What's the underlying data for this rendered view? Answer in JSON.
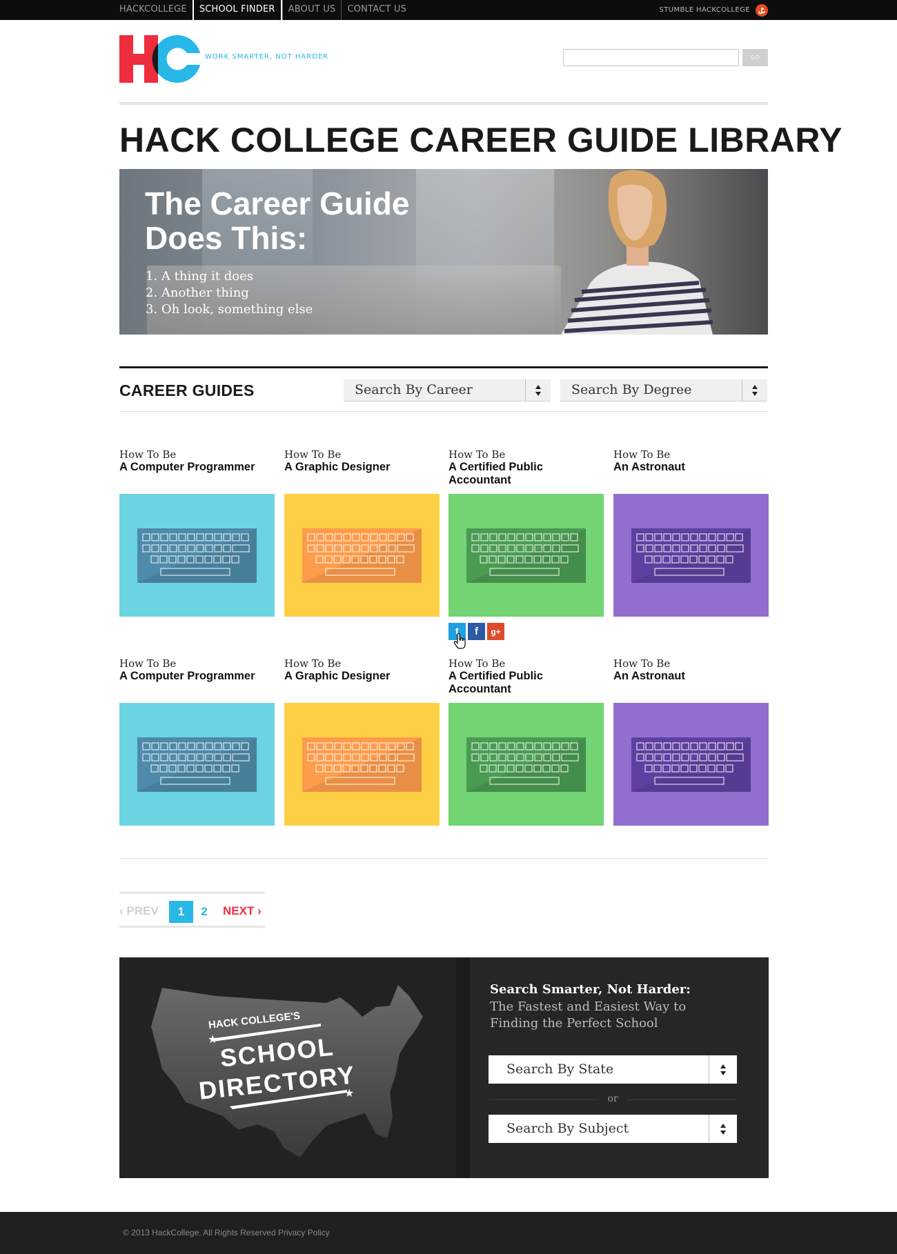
{
  "topnav": {
    "items": [
      {
        "label": "HACKCOLLEGE"
      },
      {
        "label": "SCHOOL FINDER"
      },
      {
        "label": "ABOUT US"
      },
      {
        "label": "CONTACT US"
      }
    ],
    "stumble_label": "STUMBLE HACKCOLLEGE",
    "stumble_icon": "stumbleupon-icon"
  },
  "header": {
    "logo_text": "HC",
    "tagline": "WORK SMARTER, NOT HARDER",
    "search_value": "",
    "search_button": "GO"
  },
  "page_title": "HACK COLLEGE CAREER GUIDE LIBRARY",
  "hero": {
    "title": "The Career Guide Does This:",
    "items": [
      "1. A thing it does",
      "2. Another thing",
      "3. Oh look, something else"
    ]
  },
  "career_guides": {
    "title": "CAREER GUIDES",
    "career_select": "Search By Career",
    "degree_select": "Search By Degree",
    "cards": [
      {
        "pre": "How To Be",
        "name": "A Computer Programmer",
        "bg": "#6cd3e3",
        "kb": "#4e8aa9"
      },
      {
        "pre": "How To Be",
        "name": "A Graphic Designer",
        "bg": "#fecf44",
        "kb": "#fd9c4b"
      },
      {
        "pre": "How To Be",
        "name": "A Certified Public Accountant",
        "bg": "#72d473",
        "kb": "#4a9b52"
      },
      {
        "pre": "How To Be",
        "name": "An Astronaut",
        "bg": "#926ecf",
        "kb": "#5f3f9f"
      },
      {
        "pre": "How To Be",
        "name": "A Computer Programmer",
        "bg": "#6cd3e3",
        "kb": "#4e8aa9"
      },
      {
        "pre": "How To Be",
        "name": "A Graphic Designer",
        "bg": "#fecf44",
        "kb": "#fd9c4b"
      },
      {
        "pre": "How To Be",
        "name": "A Certified Public Accountant",
        "bg": "#72d473",
        "kb": "#4a9b52"
      },
      {
        "pre": "How To Be",
        "name": "An Astronaut",
        "bg": "#926ecf",
        "kb": "#5f3f9f"
      }
    ],
    "social": [
      {
        "icon": "twitter-icon",
        "glyph": "t",
        "color": "#1d9fe0"
      },
      {
        "icon": "facebook-icon",
        "glyph": "f",
        "color": "#2d5aa5"
      },
      {
        "icon": "google-plus-icon",
        "glyph": "g+",
        "color": "#dd4b2b"
      }
    ]
  },
  "pagination": {
    "prev": "PREV",
    "pages": [
      "1",
      "2"
    ],
    "current": "1",
    "next": "NEXT"
  },
  "directory": {
    "art_line1": "HACK COLLEGE'S",
    "art_line2": "SCHOOL",
    "art_line3": "DIRECTORY",
    "heading": "Search Smarter, Not Harder:",
    "subheading": "The Fastest and Easiest Way to Finding the Perfect School",
    "state_select": "Search By State",
    "or_label": "or",
    "subject_select": "Search By Subject"
  },
  "footer": {
    "copyright": "© 2013 HackCollege. All Rights Reserved",
    "privacy": "Privacy Policy"
  },
  "colors": {
    "accent_blue": "#27b8e8",
    "accent_red": "#ee2d3e",
    "dark": "#0d0d0d"
  }
}
